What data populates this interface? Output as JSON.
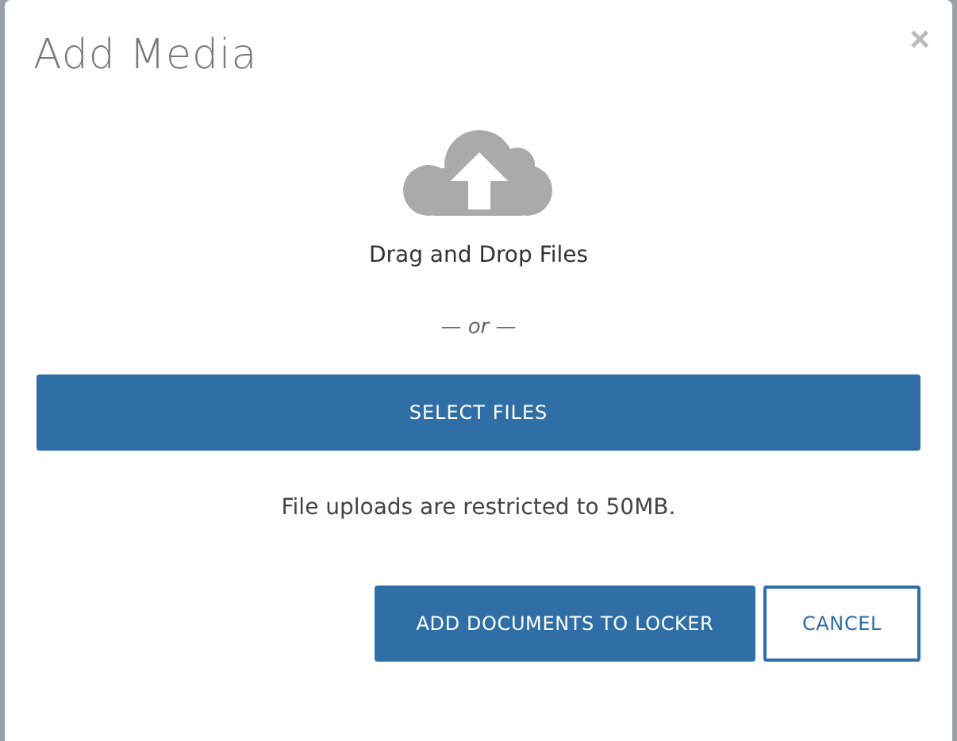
{
  "dialog": {
    "title": "Add Media",
    "close": "×"
  },
  "dropzone": {
    "label": "Drag and Drop Files",
    "separator": "— or —",
    "select_button": "SELECT FILES"
  },
  "note": "File uploads are restricted to 50MB.",
  "buttons": [
    {
      "label": "ADD DOCUMENTS TO LOCKER",
      "kind": "primary"
    },
    {
      "label": "CANCEL",
      "kind": "secondary"
    }
  ]
}
